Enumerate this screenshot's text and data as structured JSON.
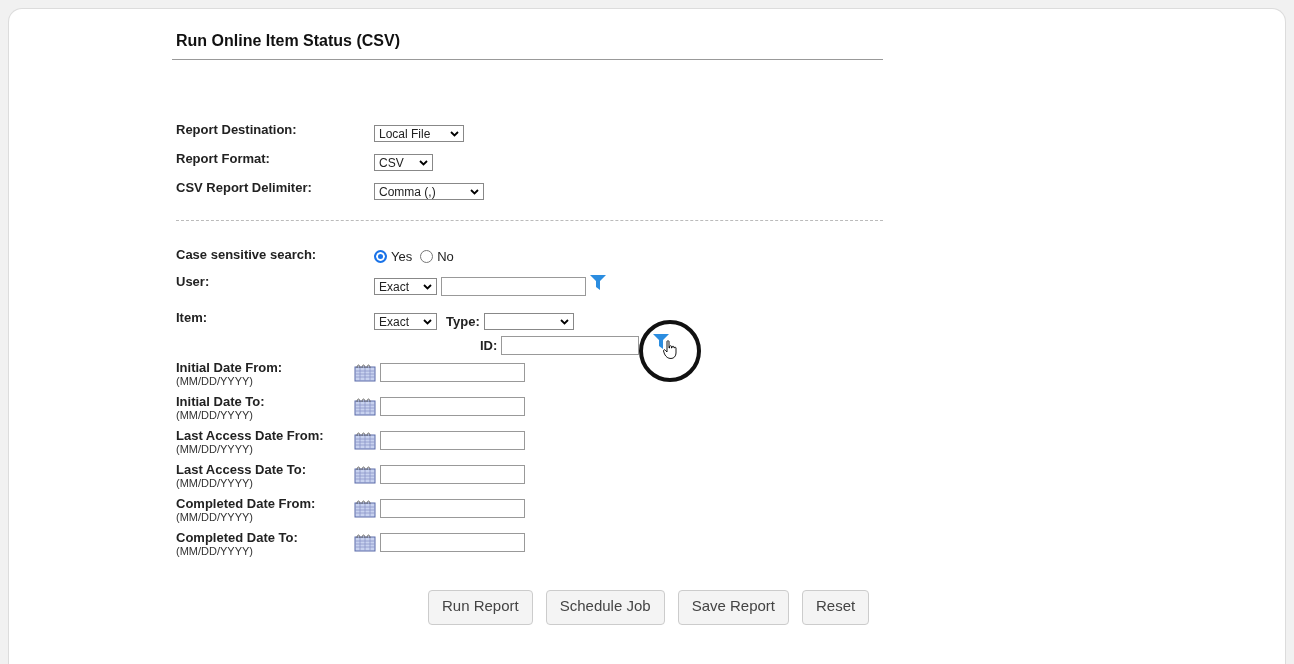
{
  "title": "Run Online Item Status (CSV)",
  "report_settings": [
    {
      "label": "Report Destination:",
      "value": "Local File"
    },
    {
      "label": "Report Format:",
      "value": "CSV"
    },
    {
      "label": "CSV Report Delimiter:",
      "value": "Comma (,)"
    }
  ],
  "case_sensitive": {
    "label": "Case sensitive search:",
    "options": [
      {
        "label": "Yes",
        "selected": true
      },
      {
        "label": "No",
        "selected": false
      }
    ]
  },
  "user": {
    "label": "User:",
    "match": "Exact"
  },
  "item": {
    "label": "Item:",
    "match": "Exact",
    "type_label": "Type:",
    "id_label": "ID:",
    "filter_highlighted": true
  },
  "date_fields": [
    {
      "label": "Initial Date From:",
      "hint": "(MM/DD/YYYY)"
    },
    {
      "label": "Initial Date To:",
      "hint": "(MM/DD/YYYY)"
    },
    {
      "label": "Last Access Date From:",
      "hint": "(MM/DD/YYYY)"
    },
    {
      "label": "Last Access Date To:",
      "hint": "(MM/DD/YYYY)"
    },
    {
      "label": "Completed Date From:",
      "hint": "(MM/DD/YYYY)"
    },
    {
      "label": "Completed Date To:",
      "hint": "(MM/DD/YYYY)"
    }
  ],
  "buttons": [
    "Run Report",
    "Schedule Job",
    "Save Report",
    "Reset"
  ]
}
